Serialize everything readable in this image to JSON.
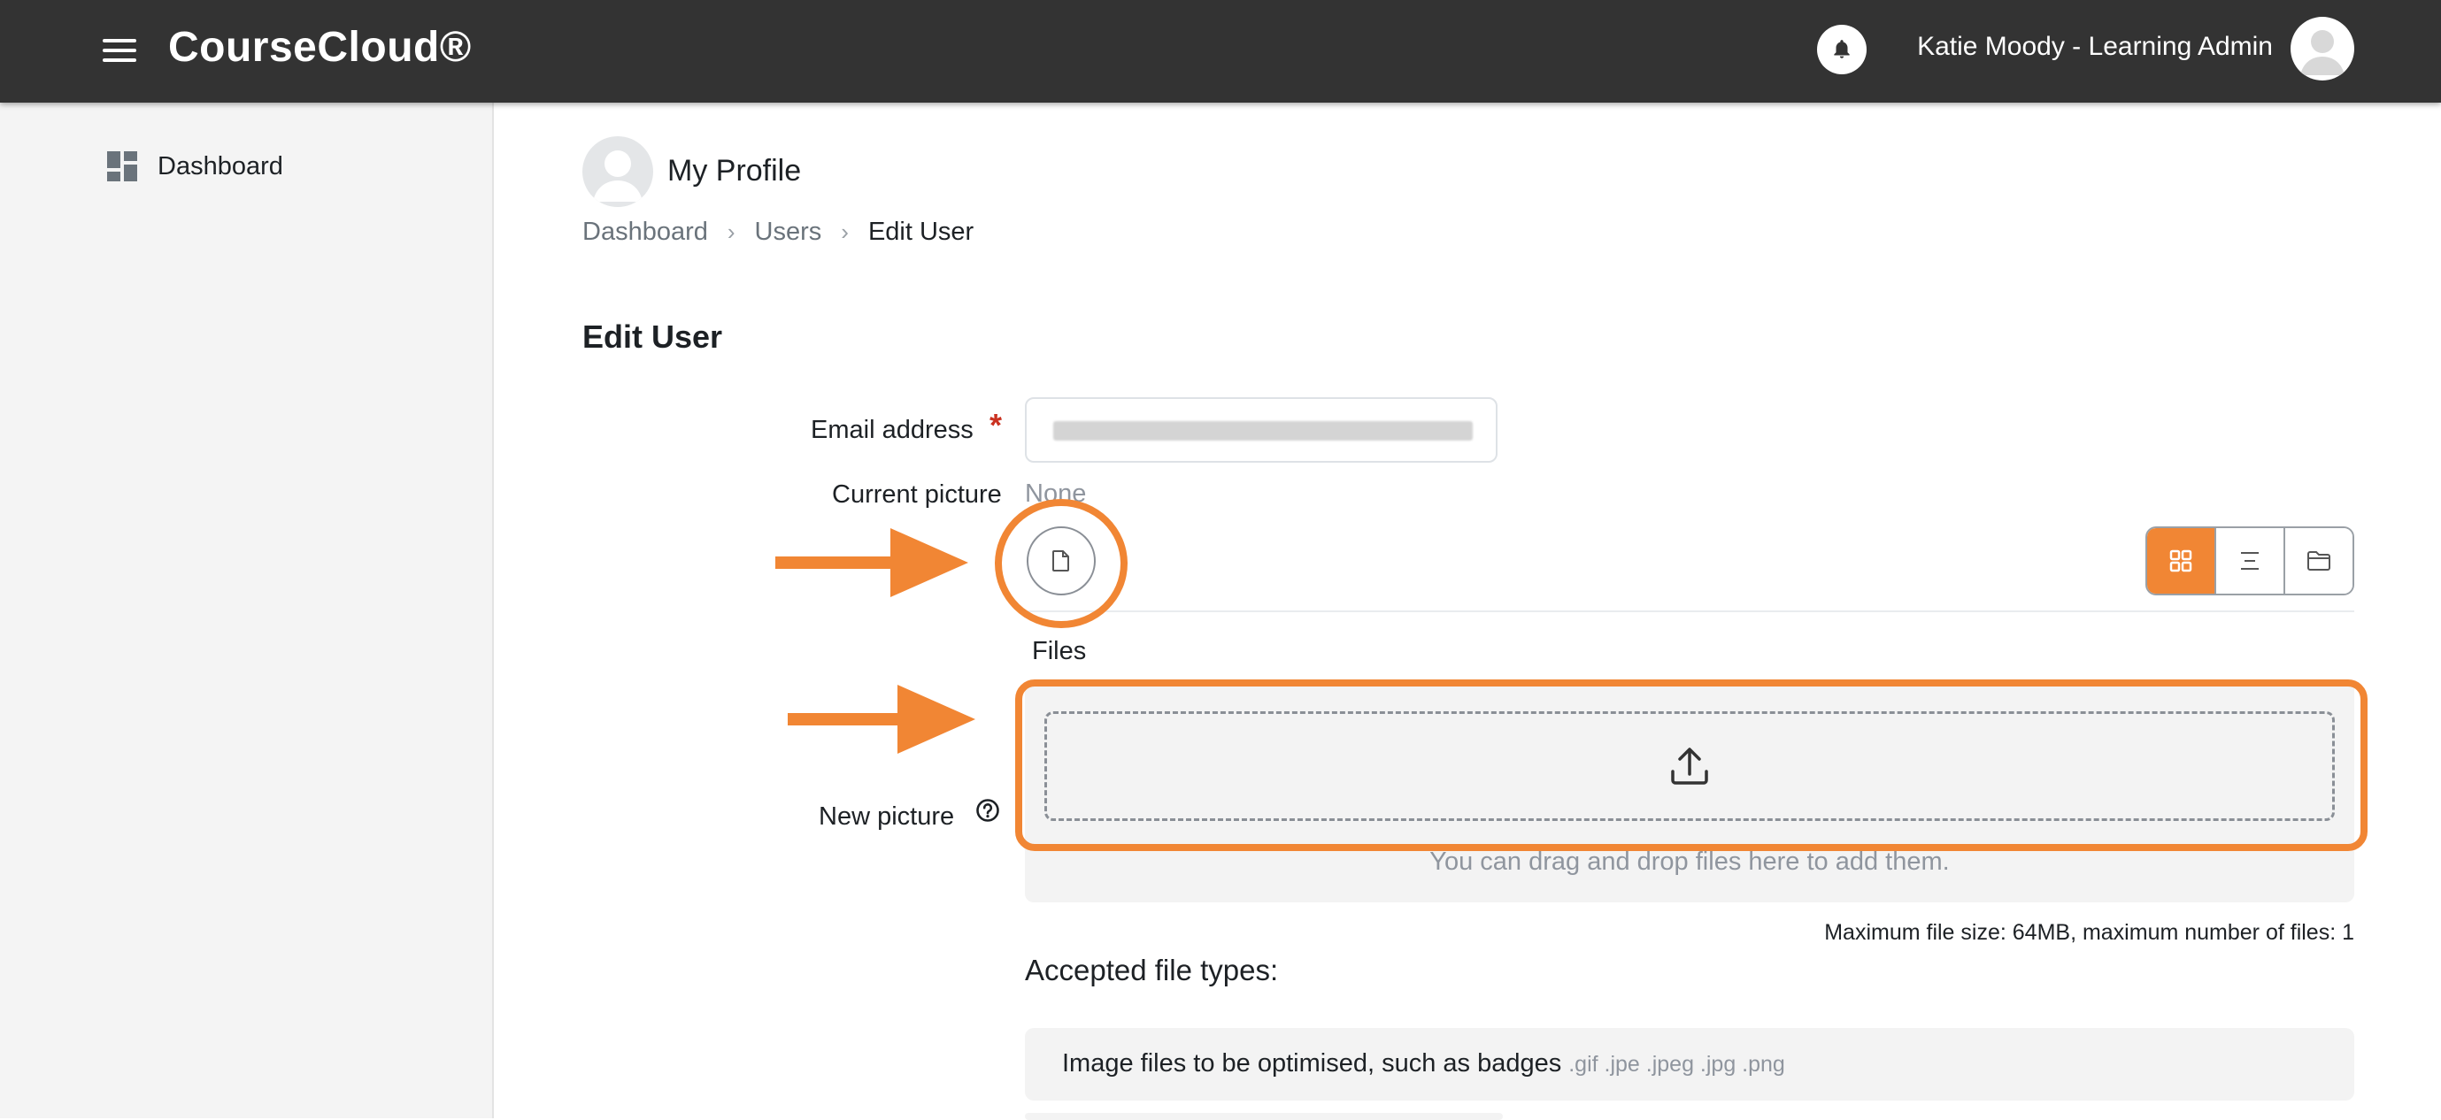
{
  "app": {
    "brand": "CourseCloud®",
    "user_name": "Katie Moody - Learning Admin"
  },
  "icons": {
    "menu": "hamburger-menu-icon",
    "notifications": "bell-icon",
    "avatar": "user-avatar-icon",
    "dashboard": "dashboard-grid-icon",
    "add_file": "file-icon",
    "view_icons": "grid-icon",
    "view_details": "list-icon",
    "view_tree": "folder-icon",
    "upload": "upload-icon",
    "help": "question-circle-icon"
  },
  "sidebar": {
    "items": [
      {
        "label": "Dashboard"
      }
    ]
  },
  "page": {
    "profile_title": "My Profile",
    "breadcrumb": [
      "Dashboard",
      "Users",
      "Edit User"
    ],
    "section_title": "Edit User"
  },
  "form": {
    "email_label": "Email address",
    "required_mark": "*",
    "current_picture_label": "Current picture",
    "current_picture_value": "None",
    "new_picture_label": "New picture",
    "files_label": "Files",
    "dropzone_hint": "You can drag and drop files here to add them.",
    "max_size_text": "Maximum file size: 64MB, maximum number of files: 1",
    "accepted_title": "Accepted file types:",
    "accepted_types": [
      {
        "name": "Image files to be optimised, such as badges",
        "extensions": ".gif .jpe .jpeg .jpg .png"
      }
    ]
  },
  "colors": {
    "navbar": "#333333",
    "accent": "#f18634",
    "required": "#ca3120",
    "sidebar_bg": "#f4f4f4"
  }
}
